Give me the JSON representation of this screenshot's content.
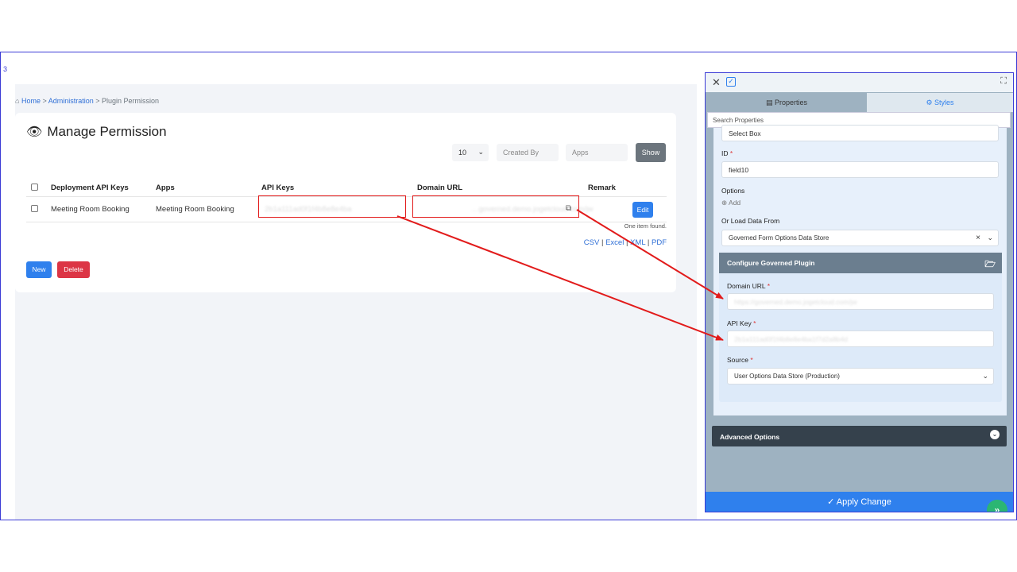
{
  "slide_number": "3",
  "breadcrumb": {
    "home": "Home",
    "sep1": " > ",
    "admin": "Administration",
    "sep2": " > ",
    "current": "Plugin Permission"
  },
  "page": {
    "title": "Manage Permission"
  },
  "filters": {
    "page_size": "10",
    "created_by_placeholder": "Created By",
    "apps_placeholder": "Apps",
    "show_label": "Show"
  },
  "table": {
    "headers": {
      "deployment": "Deployment API Keys",
      "apps": "Apps",
      "api_keys": "API Keys",
      "domain_url": "Domain URL",
      "remark": "Remark"
    },
    "rows": [
      {
        "deployment": "Meeting Room Booking",
        "apps": "Meeting Room Booking",
        "api_key": "2b1a111ad0f1f4b8e8e4ba",
        "domain_url": "…governed.demo.jogetcloud.com/jw",
        "edit_label": "Edit"
      }
    ],
    "found_text": "One item found."
  },
  "export": {
    "csv": "CSV",
    "sep": " | ",
    "excel": "Excel",
    "xml": "XML",
    "pdf": "PDF"
  },
  "actions": {
    "new_label": "New",
    "delete_label": "Delete"
  },
  "panel": {
    "tab_properties": "Properties",
    "tab_styles": "Styles",
    "search_placeholder": "Search Properties",
    "select_box_value": "Select Box",
    "id_label": "ID",
    "id_value": "field10",
    "options_label": "Options",
    "add_label": "Add",
    "load_data_label": "Or Load Data From",
    "load_data_value": "Governed Form Options Data Store",
    "clear_symbol": "×",
    "governed": {
      "header": "Configure Governed Plugin",
      "domain_url_label": "Domain URL",
      "domain_url_value": "https://governed.demo.jogetcloud.com/jw",
      "api_key_label": "API Key",
      "api_key_value": "2b1a111ad0f1f4b8e8e4ba1f7d2a8b4d",
      "source_label": "Source",
      "source_value": "User Options Data Store (Production)"
    },
    "advanced_options": "Advanced Options",
    "apply_change": "Apply Change"
  },
  "colors": {
    "primary": "#2f80ed",
    "danger": "#dc3545",
    "annotation": "#e21b1b",
    "panel_bg": "#9eb2c1"
  }
}
